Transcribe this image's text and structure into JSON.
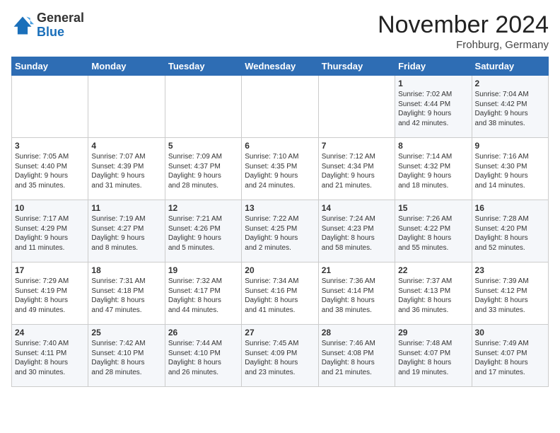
{
  "header": {
    "logo_general": "General",
    "logo_blue": "Blue",
    "month_title": "November 2024",
    "subtitle": "Frohburg, Germany"
  },
  "days_of_week": [
    "Sunday",
    "Monday",
    "Tuesday",
    "Wednesday",
    "Thursday",
    "Friday",
    "Saturday"
  ],
  "weeks": [
    [
      {
        "day": "",
        "info": ""
      },
      {
        "day": "",
        "info": ""
      },
      {
        "day": "",
        "info": ""
      },
      {
        "day": "",
        "info": ""
      },
      {
        "day": "",
        "info": ""
      },
      {
        "day": "1",
        "info": "Sunrise: 7:02 AM\nSunset: 4:44 PM\nDaylight: 9 hours\nand 42 minutes."
      },
      {
        "day": "2",
        "info": "Sunrise: 7:04 AM\nSunset: 4:42 PM\nDaylight: 9 hours\nand 38 minutes."
      }
    ],
    [
      {
        "day": "3",
        "info": "Sunrise: 7:05 AM\nSunset: 4:40 PM\nDaylight: 9 hours\nand 35 minutes."
      },
      {
        "day": "4",
        "info": "Sunrise: 7:07 AM\nSunset: 4:39 PM\nDaylight: 9 hours\nand 31 minutes."
      },
      {
        "day": "5",
        "info": "Sunrise: 7:09 AM\nSunset: 4:37 PM\nDaylight: 9 hours\nand 28 minutes."
      },
      {
        "day": "6",
        "info": "Sunrise: 7:10 AM\nSunset: 4:35 PM\nDaylight: 9 hours\nand 24 minutes."
      },
      {
        "day": "7",
        "info": "Sunrise: 7:12 AM\nSunset: 4:34 PM\nDaylight: 9 hours\nand 21 minutes."
      },
      {
        "day": "8",
        "info": "Sunrise: 7:14 AM\nSunset: 4:32 PM\nDaylight: 9 hours\nand 18 minutes."
      },
      {
        "day": "9",
        "info": "Sunrise: 7:16 AM\nSunset: 4:30 PM\nDaylight: 9 hours\nand 14 minutes."
      }
    ],
    [
      {
        "day": "10",
        "info": "Sunrise: 7:17 AM\nSunset: 4:29 PM\nDaylight: 9 hours\nand 11 minutes."
      },
      {
        "day": "11",
        "info": "Sunrise: 7:19 AM\nSunset: 4:27 PM\nDaylight: 9 hours\nand 8 minutes."
      },
      {
        "day": "12",
        "info": "Sunrise: 7:21 AM\nSunset: 4:26 PM\nDaylight: 9 hours\nand 5 minutes."
      },
      {
        "day": "13",
        "info": "Sunrise: 7:22 AM\nSunset: 4:25 PM\nDaylight: 9 hours\nand 2 minutes."
      },
      {
        "day": "14",
        "info": "Sunrise: 7:24 AM\nSunset: 4:23 PM\nDaylight: 8 hours\nand 58 minutes."
      },
      {
        "day": "15",
        "info": "Sunrise: 7:26 AM\nSunset: 4:22 PM\nDaylight: 8 hours\nand 55 minutes."
      },
      {
        "day": "16",
        "info": "Sunrise: 7:28 AM\nSunset: 4:20 PM\nDaylight: 8 hours\nand 52 minutes."
      }
    ],
    [
      {
        "day": "17",
        "info": "Sunrise: 7:29 AM\nSunset: 4:19 PM\nDaylight: 8 hours\nand 49 minutes."
      },
      {
        "day": "18",
        "info": "Sunrise: 7:31 AM\nSunset: 4:18 PM\nDaylight: 8 hours\nand 47 minutes."
      },
      {
        "day": "19",
        "info": "Sunrise: 7:32 AM\nSunset: 4:17 PM\nDaylight: 8 hours\nand 44 minutes."
      },
      {
        "day": "20",
        "info": "Sunrise: 7:34 AM\nSunset: 4:16 PM\nDaylight: 8 hours\nand 41 minutes."
      },
      {
        "day": "21",
        "info": "Sunrise: 7:36 AM\nSunset: 4:14 PM\nDaylight: 8 hours\nand 38 minutes."
      },
      {
        "day": "22",
        "info": "Sunrise: 7:37 AM\nSunset: 4:13 PM\nDaylight: 8 hours\nand 36 minutes."
      },
      {
        "day": "23",
        "info": "Sunrise: 7:39 AM\nSunset: 4:12 PM\nDaylight: 8 hours\nand 33 minutes."
      }
    ],
    [
      {
        "day": "24",
        "info": "Sunrise: 7:40 AM\nSunset: 4:11 PM\nDaylight: 8 hours\nand 30 minutes."
      },
      {
        "day": "25",
        "info": "Sunrise: 7:42 AM\nSunset: 4:10 PM\nDaylight: 8 hours\nand 28 minutes."
      },
      {
        "day": "26",
        "info": "Sunrise: 7:44 AM\nSunset: 4:10 PM\nDaylight: 8 hours\nand 26 minutes."
      },
      {
        "day": "27",
        "info": "Sunrise: 7:45 AM\nSunset: 4:09 PM\nDaylight: 8 hours\nand 23 minutes."
      },
      {
        "day": "28",
        "info": "Sunrise: 7:46 AM\nSunset: 4:08 PM\nDaylight: 8 hours\nand 21 minutes."
      },
      {
        "day": "29",
        "info": "Sunrise: 7:48 AM\nSunset: 4:07 PM\nDaylight: 8 hours\nand 19 minutes."
      },
      {
        "day": "30",
        "info": "Sunrise: 7:49 AM\nSunset: 4:07 PM\nDaylight: 8 hours\nand 17 minutes."
      }
    ]
  ]
}
